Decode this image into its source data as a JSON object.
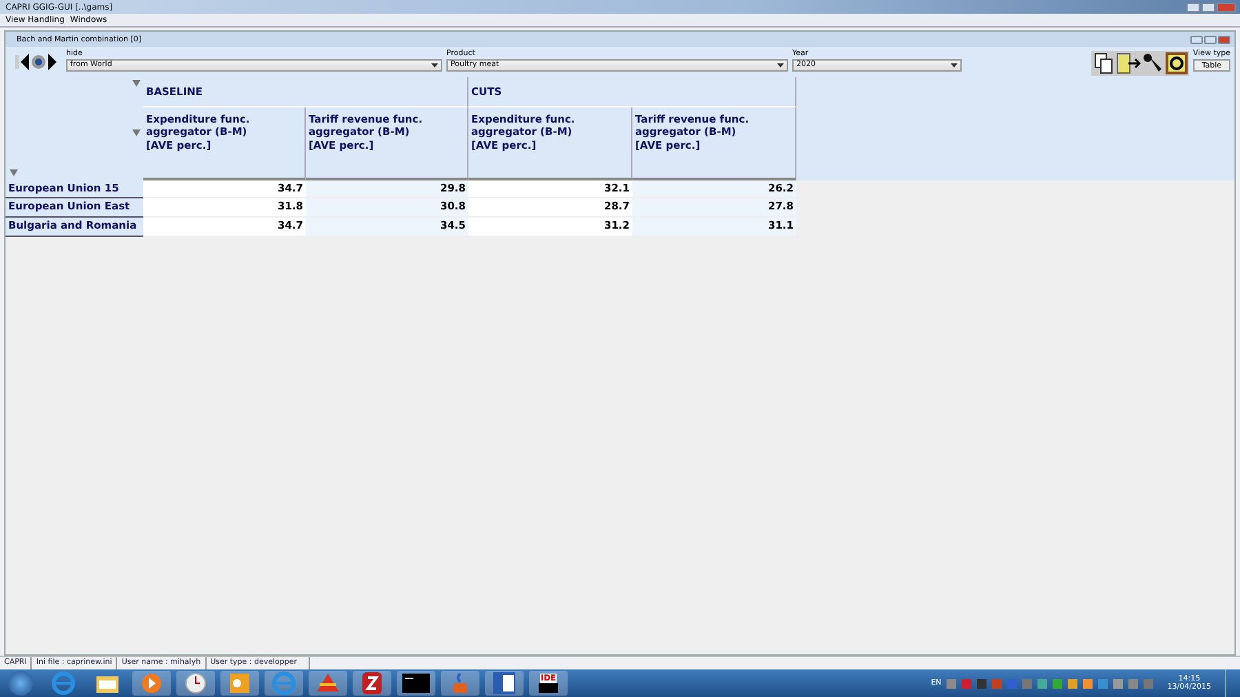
{
  "window": {
    "title": "CAPRI GGIG-GUI [..\\gams]"
  },
  "menu": [
    "View Handling",
    "Windows"
  ],
  "inner_window": {
    "title": "Bach and Martin combination [0]"
  },
  "selectors": [
    {
      "label": "hide",
      "value": "from World"
    },
    {
      "label": "Product",
      "value": "Poultry meat"
    },
    {
      "label": "Year",
      "value": "2020"
    }
  ],
  "view_type": {
    "label": "View type",
    "value": "Table"
  },
  "table": {
    "groups": [
      {
        "label": "BASELINE",
        "columns": [
          "Expenditure func. aggregator (B-M) [AVE perc.]",
          "Tariff revenue func. aggregator (B-M) [AVE perc.]"
        ]
      },
      {
        "label": "CUTS",
        "columns": [
          "Expenditure func. aggregator (B-M) [AVE perc.]",
          "Tariff revenue func. aggregator (B-M) [AVE perc.]"
        ]
      }
    ],
    "rows": [
      {
        "label": "European Union 15",
        "values": [
          "34.7",
          "29.8",
          "32.1",
          "26.2"
        ]
      },
      {
        "label": "European Union East",
        "values": [
          "31.8",
          "30.8",
          "28.7",
          "27.8"
        ]
      },
      {
        "label": "Bulgaria and Romania",
        "values": [
          "34.7",
          "34.5",
          "31.2",
          "31.1"
        ]
      }
    ]
  },
  "status_bar": [
    "CAPRI",
    "Ini file : caprinew.ini",
    "User name : mihalyh",
    "User type : developper"
  ],
  "taskbar": {
    "apps": [
      {
        "kind": "ie"
      },
      {
        "kind": "folder"
      },
      {
        "kind": "media"
      },
      {
        "kind": "clock"
      },
      {
        "kind": "outlook"
      },
      {
        "kind": "ie"
      },
      {
        "kind": "stack"
      },
      {
        "kind": "z"
      },
      {
        "kind": "terminal"
      },
      {
        "kind": "java"
      },
      {
        "kind": "word"
      },
      {
        "kind": "ide",
        "label": "IDE"
      }
    ],
    "language": "EN",
    "time": "14:15",
    "date": "13/04/2015"
  }
}
